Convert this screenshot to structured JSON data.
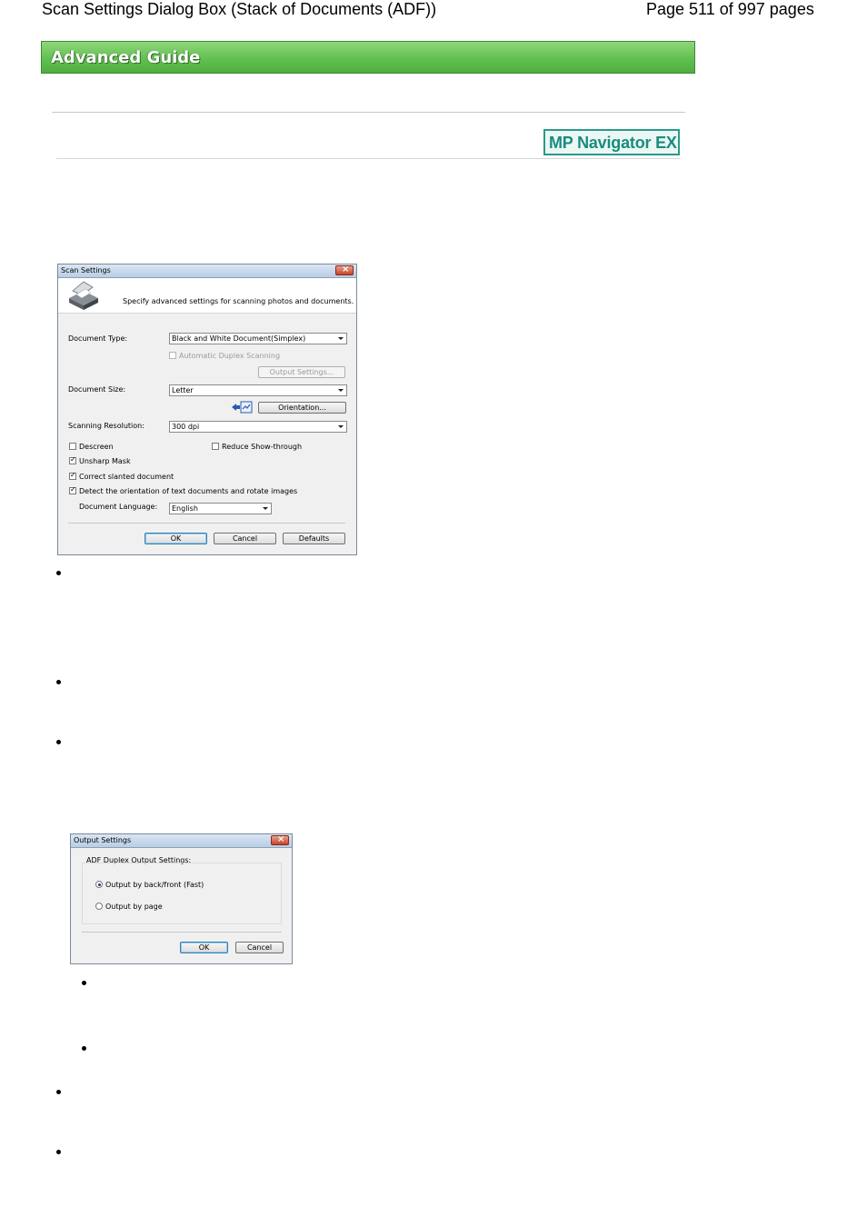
{
  "header": {
    "title": "Scan Settings Dialog Box (Stack of Documents (ADF))",
    "page_info": "Page 511 of 997 pages"
  },
  "banner": {
    "label": "Advanced Guide"
  },
  "product_badge": {
    "label": "MP Navigator EX"
  },
  "scan_settings_dialog": {
    "title": "Scan Settings",
    "description": "Specify advanced settings for scanning photos and documents.",
    "document_type": {
      "label": "Document Type:",
      "value": "Black and White Document(Simplex)"
    },
    "auto_duplex": {
      "label": "Automatic Duplex Scanning",
      "checked": false,
      "enabled": false
    },
    "output_settings_button": "Output Settings...",
    "document_size": {
      "label": "Document Size:",
      "value": "Letter"
    },
    "orientation_button": "Orientation...",
    "scanning_resolution": {
      "label": "Scanning Resolution:",
      "value": "300 dpi"
    },
    "descreen": {
      "label": "Descreen",
      "checked": false
    },
    "reduce_show_through": {
      "label": "Reduce Show-through",
      "checked": false
    },
    "unsharp_mask": {
      "label": "Unsharp Mask",
      "checked": true
    },
    "correct_slanted": {
      "label": "Correct slanted document",
      "checked": true
    },
    "detect_orientation": {
      "label": "Detect the orientation of text documents and rotate images",
      "checked": true
    },
    "document_language": {
      "label": "Document Language:",
      "value": "English"
    },
    "ok_button": "OK",
    "cancel_button": "Cancel",
    "defaults_button": "Defaults"
  },
  "output_settings_dialog": {
    "title": "Output Settings",
    "group_label": "ADF Duplex Output Settings:",
    "option_back_front": {
      "label": "Output by back/front (Fast)",
      "selected": true
    },
    "option_page": {
      "label": "Output by page",
      "selected": false
    },
    "ok_button": "OK",
    "cancel_button": "Cancel"
  }
}
